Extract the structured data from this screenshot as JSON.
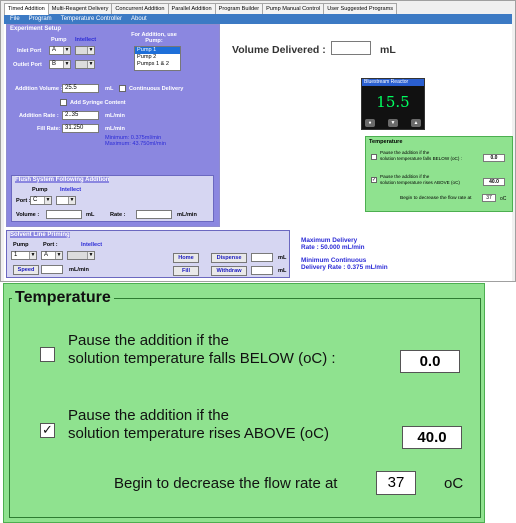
{
  "tabs": [
    "Timed Addition",
    "Multi-Reagent Delivery",
    "Concurrent Addition",
    "Parallel Addition",
    "Program Builder",
    "Pump Manual Control",
    "User Suggested Programs"
  ],
  "menu": [
    "File",
    "Program",
    "Temperature Controller",
    "About"
  ],
  "experiment_setup": {
    "title": "Experiment Setup",
    "pump_label": "Pump",
    "intellect_label": "Intellect",
    "for_addition_label": "For Addition, use Pump:",
    "inlet_port_label": "Inlet Port",
    "inlet_port_value": "A",
    "outlet_port_label": "Outlet Port",
    "outlet_port_value": "B",
    "pump_options": [
      "Pump 1",
      "Pump 2",
      "Pumps 1 & 2"
    ],
    "addition_volume_label": "Addition Volume :",
    "addition_volume_value": "25.5",
    "addition_volume_unit": "mL",
    "continuous_label": "Continuous Delivery",
    "syringe_label": "Add Syringe Content",
    "addition_rate_label": "Addition Rate :",
    "addition_rate_value": "2..35",
    "addition_rate_unit": "mL/min",
    "fill_rate_label": "Fill Rate:",
    "fill_rate_value": "31.250",
    "fill_rate_unit": "mL/min",
    "minimum_text": "Minimum: 0.375ml/min",
    "maximum_text": "Maximum: 43.750ml/min"
  },
  "flush": {
    "title": "Flush System Following Addition",
    "pump_label": "Pump",
    "intellect_label": "Intellect",
    "port_label": "Port :",
    "port_value": "C",
    "volume_label": "Volume :",
    "volume_unit": "mL",
    "rate_label": "Rate :",
    "rate_unit": "mL/min"
  },
  "solvent": {
    "title": "Solvent Line Priming",
    "pump_label": "Pump",
    "port_label": "Port :",
    "intellect_label": "Intellect",
    "pump_value": "1",
    "port_value": "A",
    "speed_label": "Speed",
    "speed_unit": "mL/min",
    "home_label": "Home",
    "fill_label": "Fill",
    "dispense_label": "Dispense",
    "withdraw_label": "Withdraw",
    "ml_unit": "mL"
  },
  "volume_delivered": {
    "label": "Volume Delivered :",
    "unit": "mL"
  },
  "display": {
    "title": "Bluestream Reactor",
    "value": "15.5"
  },
  "max_delivery": {
    "line1": "Maximum Delivery",
    "line2": "Rate : 50.000 mL/min"
  },
  "min_delivery": {
    "line1": "Minimum Continuous",
    "line2": "Delivery Rate : 0.375 mL/min"
  },
  "temperature": {
    "title": "Temperature",
    "below_line1": "Pause the addition if the",
    "below_line2": "solution temperature falls BELOW (oC) :",
    "below_value": "0.0",
    "below_checked": false,
    "above_line1": "Pause the addition if the",
    "above_line2": "solution temperature rises ABOVE (oC)",
    "above_value": "40.0",
    "above_checked": true,
    "begin_label": "Begin to decrease the flow rate at",
    "begin_value": "37",
    "begin_unit": "oC"
  },
  "colors": {
    "purple": "#8b87e0",
    "green": "#8fe28f",
    "menu_blue": "#3c7ac4",
    "lcd_green": "#00ff60"
  }
}
